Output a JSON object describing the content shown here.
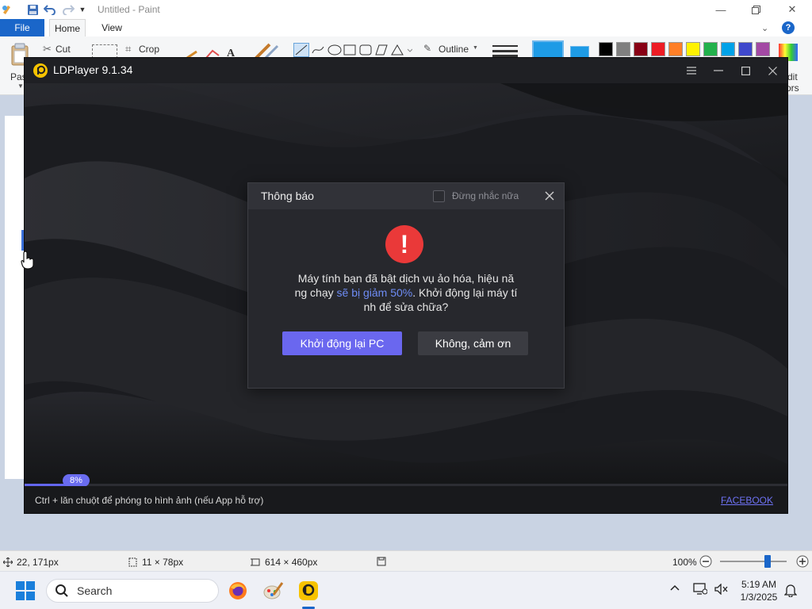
{
  "paint": {
    "title": "Untitled - Paint",
    "tabs": [
      "File",
      "Home",
      "View"
    ],
    "help_label": "?",
    "ribbon": {
      "paste": "Pas",
      "cut": "Cut",
      "crop": "Crop",
      "outline": "Outline",
      "edit_colors": "dit",
      "edit_colors_2": "ors"
    },
    "palette": [
      "#000000",
      "#7f7f7f",
      "#880015",
      "#ed1c24",
      "#ff7f27",
      "#fff200",
      "#22b14c",
      "#00a2e8",
      "#3f48cc",
      "#a349a4"
    ],
    "status": {
      "cursor_pos": "22, 171px",
      "selection_size": "11 × 78px",
      "image_size": "614 × 460px",
      "zoom": "100%",
      "zoom_level_pct": 72
    }
  },
  "ldplayer": {
    "title": "LDPlayer 9.1.34",
    "progress_pct": 8,
    "progress_label": "8%",
    "hint": "Ctrl + lăn chuột để phóng to hình ảnh (nếu App hỗ trợ)",
    "facebook_link": "FACEBOOK",
    "dialog": {
      "title": "Thông báo",
      "dont_remind": "Đừng nhắc nữa",
      "alert_glyph": "!",
      "message": {
        "line1": "Máy tính bạn đã bật dịch vụ ảo hóa, hiệu nă",
        "line2_pre": "ng chạy ",
        "line2_highlight": "sẽ bị giảm 50%",
        "line2_post": ". Khởi động lại máy tí",
        "line3": "nh để sửa chữa?"
      },
      "primary_button": "Khởi động lại PC",
      "secondary_button": "Không, cảm ơn"
    }
  },
  "taskbar": {
    "search_placeholder": "Search",
    "clock_time": "5:19 AM",
    "clock_date": "1/3/2025"
  },
  "colors": {
    "accent": "#6a67ef",
    "alert": "#ea3939",
    "link": "#6e72f5",
    "paint_file_tab": "#1a66c9"
  }
}
